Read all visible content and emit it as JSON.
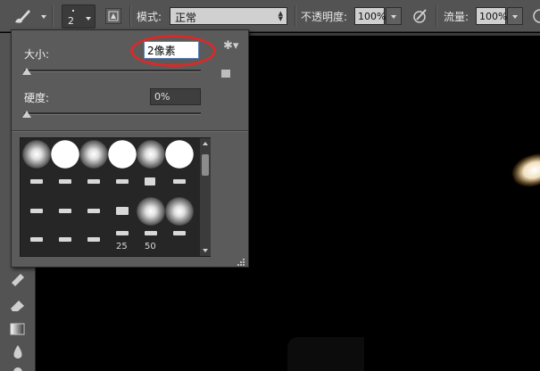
{
  "options_bar": {
    "brush_size": "2",
    "mode_label": "模式:",
    "mode_value": "正常",
    "opacity_label": "不透明度:",
    "opacity_value": "100%",
    "flow_label": "流量:",
    "flow_value": "100%"
  },
  "brush_panel": {
    "size_label": "大小:",
    "size_value": "2像素",
    "hardness_label": "硬度:",
    "hardness_value": "0%",
    "preset_sizes": [
      "25",
      "50"
    ]
  },
  "colors": {
    "ui_gray": "#535353",
    "panel_gray": "#5b5b5b",
    "annotation_red": "#d92a2a",
    "canvas": "#000000"
  }
}
